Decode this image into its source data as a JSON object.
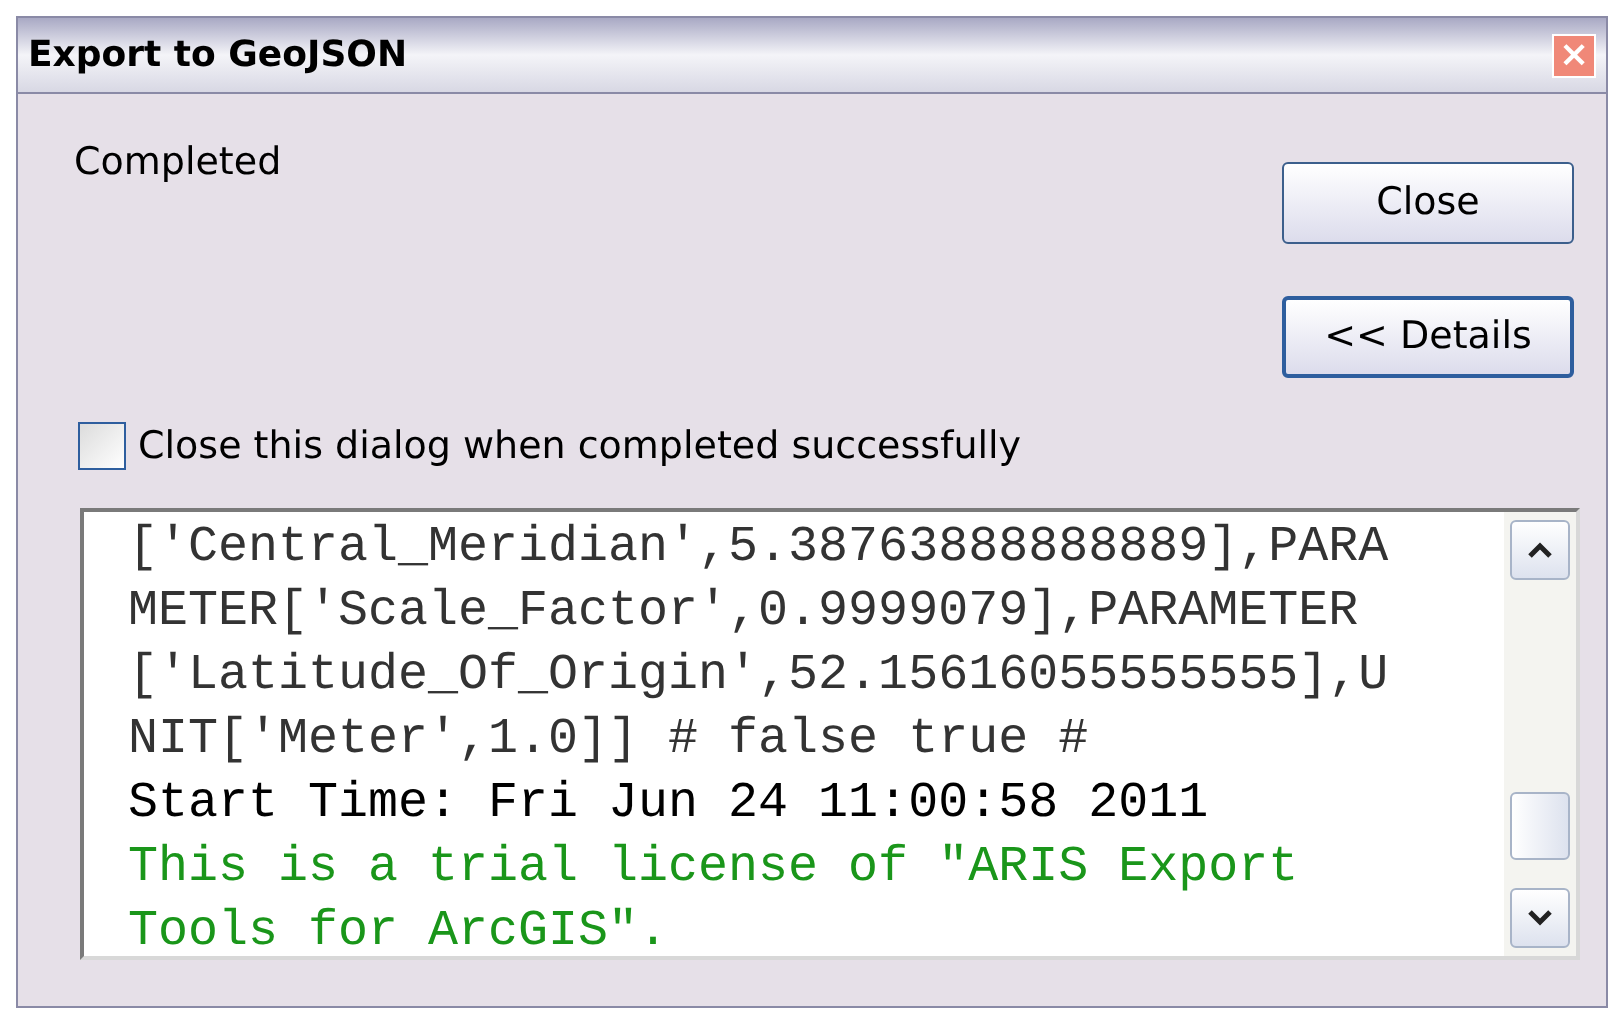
{
  "window": {
    "title": "Export to GeoJSON",
    "close_glyph": "×"
  },
  "status": "Completed",
  "buttons": [
    {
      "label": "Close",
      "focused": false
    },
    {
      "label": "<< Details",
      "focused": true
    }
  ],
  "close_on_complete": {
    "label": "Close this dialog when completed successfully",
    "checked": false
  },
  "log": [
    {
      "kind": "param",
      "text": "['Central_Meridian',5.38763888888889],PARA"
    },
    {
      "kind": "param",
      "text": "METER['Scale_Factor',0.9999079],PARAMETER"
    },
    {
      "kind": "param",
      "text": "['Latitude_Of_Origin',52.15616055555555],U"
    },
    {
      "kind": "param",
      "text": "NIT['Meter',1.0]] # false true #"
    },
    {
      "kind": "info",
      "text": "Start Time: Fri Jun 24 11:00:58 2011"
    },
    {
      "kind": "license",
      "text": "This is a trial license of \"ARIS Export"
    },
    {
      "kind": "license",
      "text": "Tools for ArcGIS\"."
    }
  ]
}
